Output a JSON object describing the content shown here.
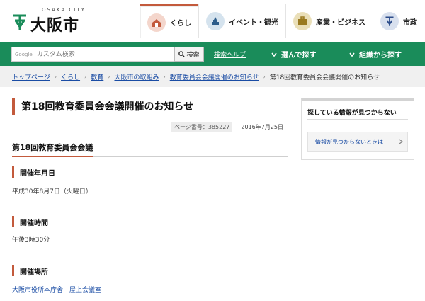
{
  "header": {
    "logo_en": "OSAKA CITY",
    "logo_jp": "大阪市",
    "nav": [
      {
        "label": "くらし",
        "icon": "house-icon"
      },
      {
        "label": "イベント・観光",
        "icon": "castle-icon"
      },
      {
        "label": "産業・ビジネス",
        "icon": "briefcase-icon"
      },
      {
        "label": "市政",
        "icon": "city-emblem-icon"
      }
    ]
  },
  "search": {
    "google_label": "Google",
    "placeholder": "カスタム検索",
    "button_label": "検索",
    "help_link": "検索ヘルプ",
    "nav_buttons": [
      "選んで探す",
      "組織から探す"
    ]
  },
  "breadcrumb": {
    "links": [
      "トップページ",
      "くらし",
      "教育",
      "大阪市の取組み",
      "教育委員会会議開催のお知らせ"
    ],
    "current": "第18回教育委員会会議開催のお知らせ"
  },
  "main": {
    "title": "第18回教育委員会会議開催のお知らせ",
    "page_number": "ページ番号：385227",
    "date": "2016年7月25日",
    "section_title": "第18回教育委員会会議",
    "items": [
      {
        "heading": "開催年月日",
        "text": "平成30年8月7日（火曜日）"
      },
      {
        "heading": "開催時間",
        "text": "午後3時30分"
      },
      {
        "heading": "開催場所",
        "text": "大阪市役所本庁舎　屋上会議室"
      }
    ]
  },
  "sidebar": {
    "title": "探している情報が見つからない",
    "link": "情報が見つからないときは"
  },
  "colors": {
    "brand_green": "#1a8c5a",
    "accent_red": "#c35a3c",
    "link_blue": "#1a4ca4"
  }
}
